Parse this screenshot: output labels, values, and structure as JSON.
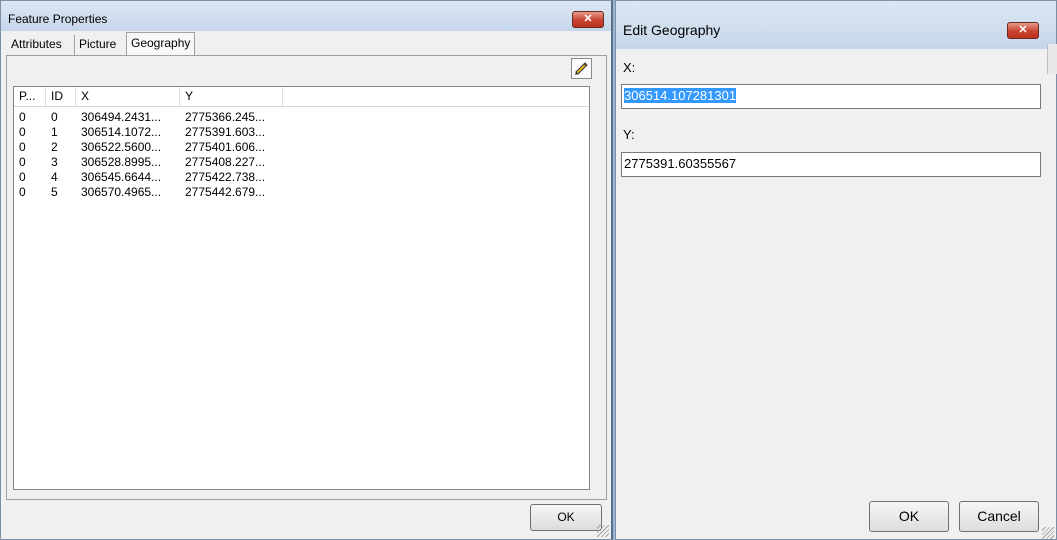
{
  "feature_properties": {
    "title": "Feature Properties",
    "close_label": "✕",
    "tabs": [
      {
        "label": "Attributes"
      },
      {
        "label": "Picture"
      },
      {
        "label": "Geography"
      }
    ],
    "list": {
      "columns": [
        "P...",
        "ID",
        "X",
        "Y"
      ],
      "rows": [
        [
          "0",
          "0",
          "306494.2431...",
          "2775366.245..."
        ],
        [
          "0",
          "1",
          "306514.1072...",
          "2775391.603..."
        ],
        [
          "0",
          "2",
          "306522.5600...",
          "2775401.606..."
        ],
        [
          "0",
          "3",
          "306528.8995...",
          "2775408.227..."
        ],
        [
          "0",
          "4",
          "306545.6644...",
          "2775422.738..."
        ],
        [
          "0",
          "5",
          "306570.4965...",
          "2775442.679..."
        ]
      ]
    },
    "ok_label": "OK"
  },
  "edit_geography": {
    "title": "Edit Geography",
    "close_label": "✕",
    "x_label": "X:",
    "x_value": "306514.107281301",
    "y_label": "Y:",
    "y_value": "2775391.60355567",
    "ok_label": "OK",
    "cancel_label": "Cancel"
  },
  "icons": {
    "edit": "pencil-icon",
    "close": "close-icon",
    "resize": "resize-grip-icon"
  }
}
